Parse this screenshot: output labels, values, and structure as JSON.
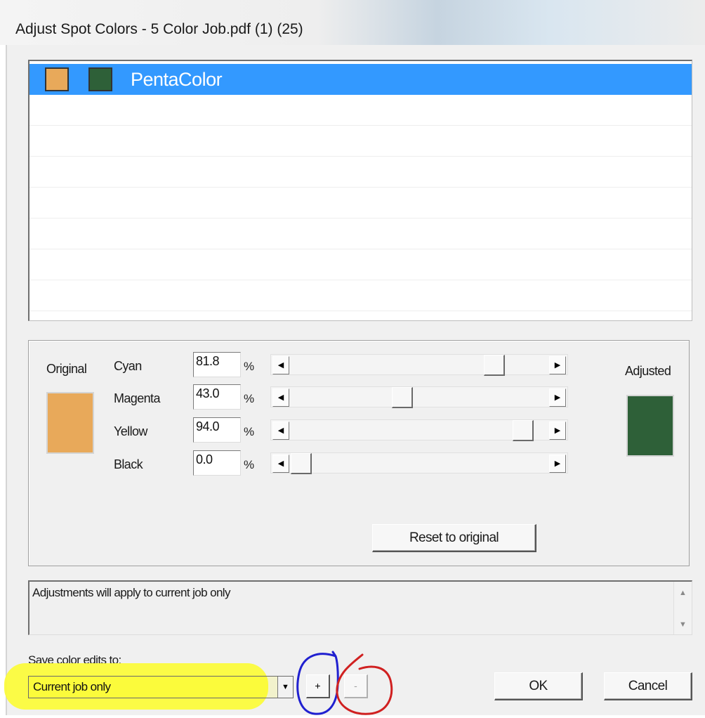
{
  "window": {
    "title": "Adjust Spot Colors - 5 Color Job.pdf (1) (25)"
  },
  "color_list": {
    "items": [
      {
        "label": "PentaColor",
        "original_color": "#e8a95a",
        "adjusted_color": "#2e6038",
        "selected": true
      }
    ]
  },
  "adjust_panel": {
    "original_label": "Original",
    "adjusted_label": "Adjusted",
    "original_color": "#e8a95a",
    "adjusted_color": "#2e6038",
    "percent_sign": "%",
    "channels": [
      {
        "name": "Cyan",
        "value": "81.8",
        "level": 81.8
      },
      {
        "name": "Magenta",
        "value": "43.0",
        "level": 43.0
      },
      {
        "name": "Yellow",
        "value": "94.0",
        "level": 94.0
      },
      {
        "name": "Black",
        "value": "0.0",
        "level": 0.0
      }
    ],
    "reset_label": "Reset to original"
  },
  "info": {
    "text": "Adjustments will apply to current job only"
  },
  "save": {
    "label": "Save color edits to:",
    "selected": "Current job only",
    "add_label": "+",
    "remove_label": "-"
  },
  "buttons": {
    "ok": "OK",
    "cancel": "Cancel"
  },
  "annotations": {
    "highlight_color": "#fbfb3c",
    "circle_add_color": "#2020d0",
    "circle_remove_color": "#d02020"
  }
}
